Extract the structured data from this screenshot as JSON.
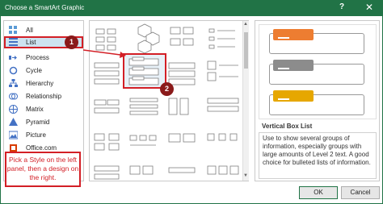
{
  "window": {
    "title": "Choose a SmartArt Graphic",
    "help": "?",
    "close": "✕"
  },
  "categories": [
    {
      "label": "All",
      "icon": "all-icon"
    },
    {
      "label": "List",
      "icon": "list-icon",
      "selected": true
    },
    {
      "label": "Process",
      "icon": "process-icon"
    },
    {
      "label": "Cycle",
      "icon": "cycle-icon"
    },
    {
      "label": "Hierarchy",
      "icon": "hierarchy-icon"
    },
    {
      "label": "Relationship",
      "icon": "relationship-icon"
    },
    {
      "label": "Matrix",
      "icon": "matrix-icon"
    },
    {
      "label": "Pyramid",
      "icon": "pyramid-icon"
    },
    {
      "label": "Picture",
      "icon": "picture-icon"
    },
    {
      "label": "Office.com",
      "icon": "office-icon"
    }
  ],
  "detail": {
    "name": "Vertical Box List",
    "description": "Use to show several groups of information, especially groups with large amounts of Level 2 text. A good choice for bulleted lists of information."
  },
  "colors": {
    "accent": "#217346",
    "highlight": "#d31f26",
    "orange": "#ed7d31",
    "gray": "#8c8c8c",
    "gold": "#e6a700"
  },
  "buttons": {
    "ok": "OK",
    "cancel": "Cancel"
  },
  "annotations": {
    "badge1": "1",
    "badge2": "2",
    "callout": "Pick a Style on the left panel, then a design on the right."
  }
}
